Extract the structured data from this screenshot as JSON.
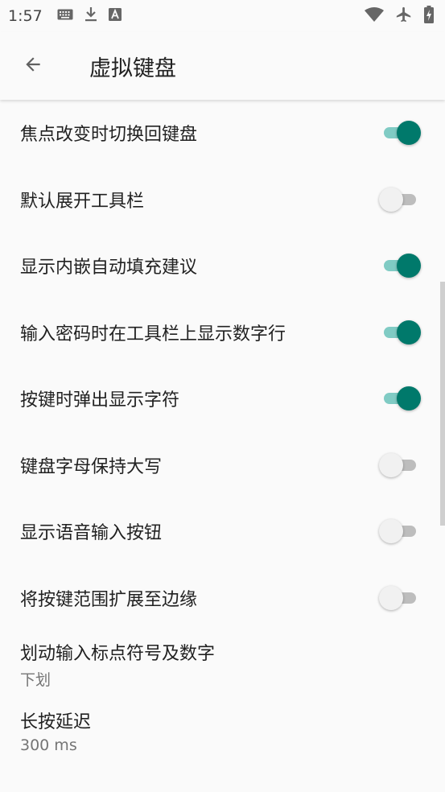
{
  "status_bar": {
    "time": "1:57",
    "left_icons": [
      "keyboard-icon",
      "download-icon",
      "font-a-icon"
    ],
    "right_icons": [
      "wifi-icon",
      "airplane-icon",
      "battery-charging-icon"
    ]
  },
  "app_bar": {
    "back_icon": "arrow-left-icon",
    "title": "虚拟键盘"
  },
  "colors": {
    "accent": "#00796b",
    "accent_track": "#80cbc4",
    "off_thumb": "#f1f1f1",
    "off_track": "#bdbdbd"
  },
  "settings": [
    {
      "label": "焦点改变时切换回键盘",
      "enabled": true
    },
    {
      "label": "默认展开工具栏",
      "enabled": false
    },
    {
      "label": "显示内嵌自动填充建议",
      "enabled": true
    },
    {
      "label": "输入密码时在工具栏上显示数字行",
      "enabled": true
    },
    {
      "label": "按键时弹出显示字符",
      "enabled": true
    },
    {
      "label": "键盘字母保持大写",
      "enabled": false
    },
    {
      "label": "显示语音输入按钮",
      "enabled": false
    },
    {
      "label": "将按键范围扩展至边缘",
      "enabled": false
    }
  ],
  "options": [
    {
      "label": "划动输入标点符号及数字",
      "summary": "下划"
    },
    {
      "label": "长按延迟",
      "summary": "300 ms"
    }
  ]
}
